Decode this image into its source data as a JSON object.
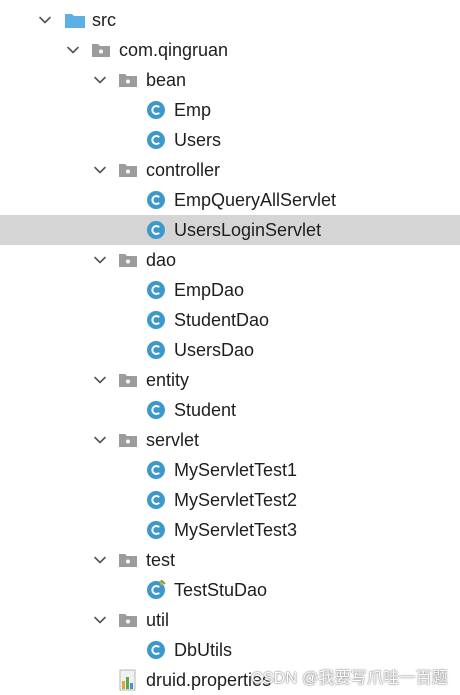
{
  "tree": [
    {
      "label": "src",
      "kind": "source-folder",
      "depth": 0,
      "expanded": true
    },
    {
      "label": "com.qingruan",
      "kind": "package",
      "depth": 1,
      "expanded": true
    },
    {
      "label": "bean",
      "kind": "package",
      "depth": 2,
      "expanded": true
    },
    {
      "label": "Emp",
      "kind": "class",
      "depth": 3
    },
    {
      "label": "Users",
      "kind": "class",
      "depth": 3
    },
    {
      "label": "controller",
      "kind": "package",
      "depth": 2,
      "expanded": true
    },
    {
      "label": "EmpQueryAllServlet",
      "kind": "class",
      "depth": 3
    },
    {
      "label": "UsersLoginServlet",
      "kind": "class",
      "depth": 3,
      "selected": true
    },
    {
      "label": "dao",
      "kind": "package",
      "depth": 2,
      "expanded": true
    },
    {
      "label": "EmpDao",
      "kind": "class",
      "depth": 3
    },
    {
      "label": "StudentDao",
      "kind": "class",
      "depth": 3
    },
    {
      "label": "UsersDao",
      "kind": "class",
      "depth": 3
    },
    {
      "label": "entity",
      "kind": "package",
      "depth": 2,
      "expanded": true
    },
    {
      "label": "Student",
      "kind": "class",
      "depth": 3
    },
    {
      "label": "servlet",
      "kind": "package",
      "depth": 2,
      "expanded": true
    },
    {
      "label": "MyServletTest1",
      "kind": "class",
      "depth": 3
    },
    {
      "label": "MyServletTest2",
      "kind": "class",
      "depth": 3
    },
    {
      "label": "MyServletTest3",
      "kind": "class",
      "depth": 3
    },
    {
      "label": "test",
      "kind": "package",
      "depth": 2,
      "expanded": true
    },
    {
      "label": "TestStuDao",
      "kind": "test-class",
      "depth": 3
    },
    {
      "label": "util",
      "kind": "package",
      "depth": 2,
      "expanded": true
    },
    {
      "label": "DbUtils",
      "kind": "class",
      "depth": 3
    },
    {
      "label": "druid.properties",
      "kind": "properties-file",
      "depth": 2
    }
  ],
  "watermark": "CSDN @我要写爪哇一百题",
  "colors": {
    "selection": "#d5d5d6",
    "class_icon": "#3d99cc",
    "folder_blue": "#5cb0e6",
    "package_gray": "#9c9c9c",
    "chevron": "#555555"
  },
  "icons": {
    "chevron": "chevron-down-icon",
    "source-folder": "source-folder-icon",
    "package": "package-icon",
    "class": "class-icon",
    "test-class": "test-class-icon",
    "properties-file": "properties-file-icon"
  }
}
